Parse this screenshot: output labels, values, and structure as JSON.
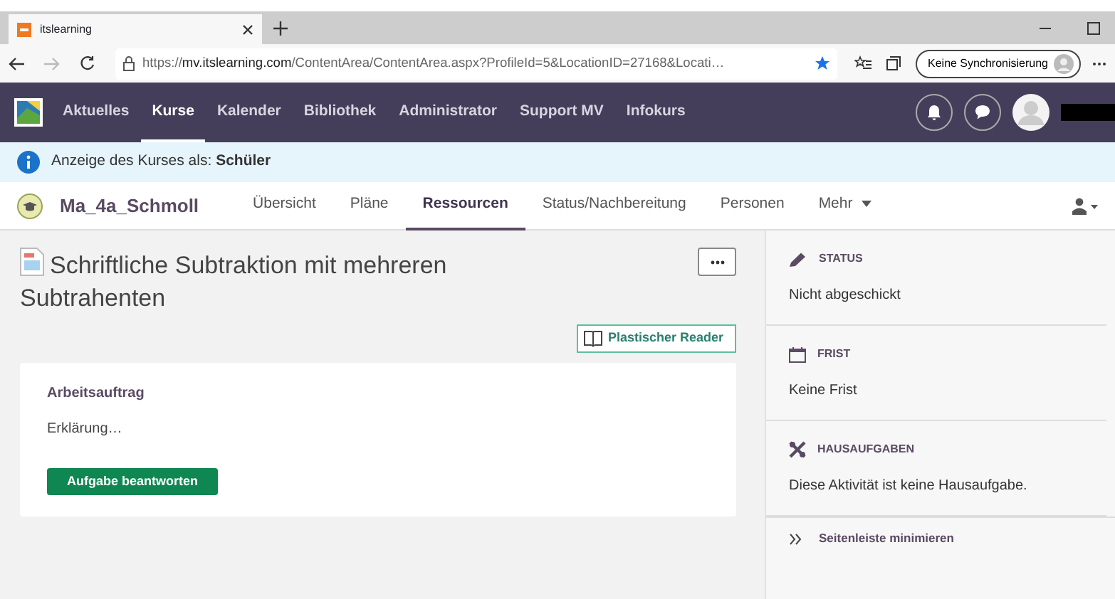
{
  "browser": {
    "tab_title": "itslearning",
    "url": "https://**mv.itslearning.com**/ContentArea/ContentArea.aspx?ProfileId=5&LocationID=27168&Locati…",
    "sync_button": "Keine Synchronisierung"
  },
  "navbar": {
    "items": [
      {
        "label": "Aktuelles",
        "selected": false
      },
      {
        "label": "Kurse",
        "selected": true
      },
      {
        "label": "Kalender",
        "selected": false
      },
      {
        "label": "Bibliothek",
        "selected": false
      },
      {
        "label": "Administrator",
        "selected": false
      },
      {
        "label": "Support MV",
        "selected": false
      },
      {
        "label": "Infokurs",
        "selected": false
      }
    ]
  },
  "info_bar": {
    "text": "Anzeige des Kurses als: **Schüler**"
  },
  "course": {
    "name": "Ma_4a_Schmoll",
    "tabs": [
      {
        "label": "Übersicht",
        "selected": false
      },
      {
        "label": "Pläne",
        "selected": false
      },
      {
        "label": "Ressourcen",
        "selected": true
      },
      {
        "label": "Status/Nachbereitung",
        "selected": false
      },
      {
        "label": "Personen",
        "selected": false
      },
      {
        "label": "Mehr",
        "selected": false
      }
    ]
  },
  "content": {
    "title": "Schriftliche Subtraktion mit mehreren Subtrahenten",
    "reader_button": "Plastischer Reader",
    "card": {
      "heading": "Arbeitsauftrag",
      "text": "Erklärung…",
      "button": "Aufgabe beantworten"
    }
  },
  "sidebar": {
    "sections": [
      {
        "kind": "status",
        "label": "STATUS",
        "value": "Nicht abgeschickt"
      },
      {
        "kind": "deadline",
        "label": "FRIST",
        "value": "Keine Frist"
      },
      {
        "kind": "homework",
        "label": "HAUSAUFGABEN",
        "value": "Diese Aktivität ist keine Hausaufgabe."
      }
    ],
    "minimize": "Seitenleiste minimieren"
  }
}
